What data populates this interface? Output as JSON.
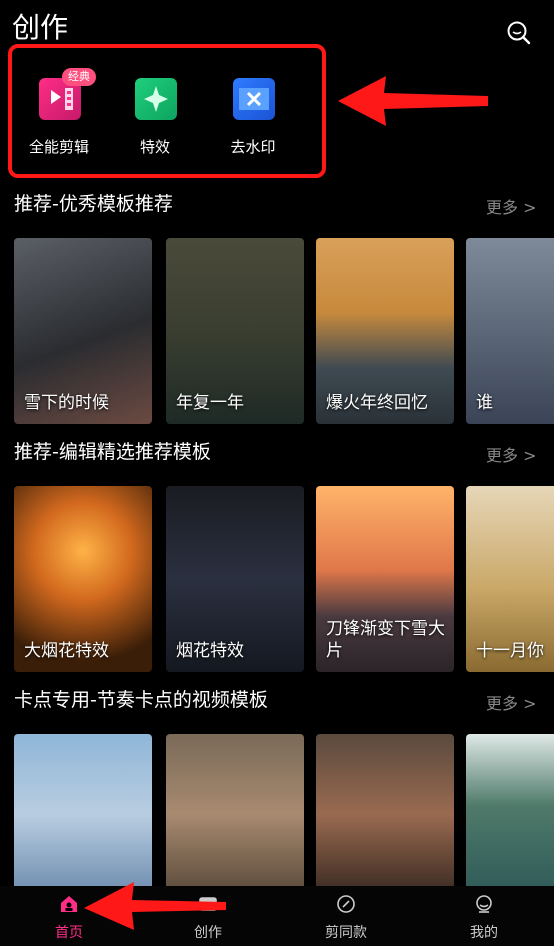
{
  "header": {
    "title": "创作"
  },
  "tools": [
    {
      "label": "全能剪辑",
      "badge": "经典",
      "icon": "video-edit-icon"
    },
    {
      "label": "特效",
      "icon": "effects-icon"
    },
    {
      "label": "去水印",
      "icon": "remove-watermark-icon"
    }
  ],
  "sections": [
    {
      "title": "推荐-优秀模板推荐",
      "more": "更多 >",
      "cards": [
        {
          "caption": "雪下的时候"
        },
        {
          "caption": "年复一年"
        },
        {
          "caption": "爆火年终回忆"
        },
        {
          "caption": "谁"
        }
      ]
    },
    {
      "title": "推荐-编辑精选推荐模板",
      "more": "更多 >",
      "cards": [
        {
          "caption": "大烟花特效"
        },
        {
          "caption": "烟花特效"
        },
        {
          "caption": "刀锋渐变下雪大片"
        },
        {
          "caption": "十一月你"
        }
      ]
    },
    {
      "title": "卡点专用-节奏卡点的视频模板",
      "more": "更多 >",
      "cards": [
        {
          "caption": ""
        },
        {
          "caption": ""
        },
        {
          "caption": ""
        },
        {
          "caption": ""
        }
      ]
    }
  ],
  "tabbar": [
    {
      "label": "首页",
      "icon": "home-icon",
      "active": true
    },
    {
      "label": "创作",
      "icon": "create-icon",
      "active": false
    },
    {
      "label": "剪同款",
      "icon": "template-icon",
      "active": false
    },
    {
      "label": "我的",
      "icon": "profile-icon",
      "active": false
    }
  ],
  "colors": {
    "accent": "#ff2d86",
    "annotation": "#ff1818"
  }
}
